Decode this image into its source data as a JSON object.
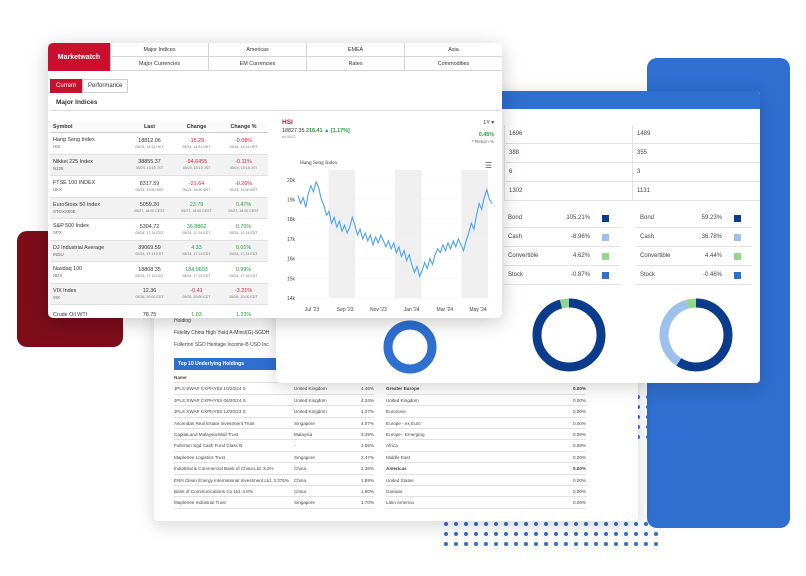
{
  "colors": {
    "brand_red": "#c8102e",
    "brand_blue": "#2f6fd0",
    "positive": "#21a03c",
    "negative": "#d6202e",
    "line": "#4aa3f0"
  },
  "marketwatch": {
    "tab_label": "Marketwatch",
    "regions": [
      "Major Indices",
      "Americas",
      "EMEA",
      "Asia",
      "Major Currencies",
      "EM Currencies",
      "Rates",
      "Commodities"
    ],
    "sub_tabs": [
      "Current",
      "Performance"
    ],
    "section_title": "Major Indices",
    "columns": [
      "Symbol",
      "Last",
      "Change",
      "Change %"
    ],
    "rows": [
      {
        "name": "Hang Seng Index",
        "sym": "HSI",
        "last": "18812.06",
        "last_date": "05/24, 14:31 HKT",
        "change": "-15.29",
        "change_date": "05/24, 14:31 HKT",
        "pct": "-0.08%",
        "pct_date": "05/24, 14:31 HKT",
        "dir": "neg"
      },
      {
        "name": "Nikkei 225 Index",
        "sym": "N225",
        "last": "38855.37",
        "last_date": "05/24, 15:15 JST",
        "change": "-94.6455",
        "change_date": "05/24, 15:15 JST",
        "pct": "-0.11%",
        "pct_date": "05/24, 15:15 JST",
        "dir": "neg"
      },
      {
        "name": "FTSE 100 INDEX",
        "sym": "UKX",
        "last": "8317.59",
        "last_date": "05/24, 16:50 BST",
        "change": "-21.64",
        "change_date": "05/24, 16:50 BST",
        "pct": "-0.26%",
        "pct_date": "05/24, 16:50 BST",
        "dir": "neg"
      },
      {
        "name": "EuroStoxx 50 Index",
        "sym": "STOXX50E",
        "last": "5059.20",
        "last_date": "05/27, 18:00 CEST",
        "change": "23.79",
        "change_date": "05/27, 18:00 CEST",
        "pct": "0.47%",
        "pct_date": "05/27, 18:00 CEST",
        "dir": "pos"
      },
      {
        "name": "S&P 500 Index",
        "sym": "SPX",
        "last": "5304.72",
        "last_date": "05/24, 17:14 EDT",
        "change": "36.8802",
        "change_date": "05/24, 17:14 EDT",
        "pct": "0.70%",
        "pct_date": "05/24, 17:14 EDT",
        "dir": "pos"
      },
      {
        "name": "DJ Industrial Average",
        "sym": "INDU",
        "last": "39069.59",
        "last_date": "05/24, 17:14 EDT",
        "change": "4.33",
        "change_date": "05/24, 17:14 EDT",
        "pct": "0.01%",
        "pct_date": "05/24, 17:14 EDT",
        "dir": "pos"
      },
      {
        "name": "Nasdaq 100",
        "sym": "NDX",
        "last": "18808.35",
        "last_date": "05/24, 17:15 EDT",
        "change": "184.9603",
        "change_date": "05/24, 17:15 EDT",
        "pct": "0.99%",
        "pct_date": "05/24, 17:15 EDT",
        "dir": "pos"
      },
      {
        "name": "VIX Index",
        "sym": "VIX",
        "last": "12.36",
        "last_date": "05/26, 20:00 EDT",
        "change": "-0.41",
        "change_date": "05/26, 20:00 EDT",
        "pct": "-3.21%",
        "pct_date": "05/26, 20:00 EDT",
        "dir": "neg"
      },
      {
        "name": "Crude Oil WTI",
        "sym": "",
        "last": "78.75",
        "last_date": "",
        "change": "1.03",
        "change_date": "",
        "pct": "1.33%",
        "pct_date": "",
        "dir": "pos"
      }
    ]
  },
  "hsi": {
    "symbol": "HSI",
    "value": "18827.35",
    "change": "218.41",
    "change_pct": "[1.17%]",
    "date": "on 05/27",
    "range": "1Y",
    "return_value": "0.45%",
    "return_label": "Return %"
  },
  "chart_data": {
    "type": "line",
    "title": "Hang Seng Index",
    "xlabel": "",
    "ylabel": "",
    "x_ticks": [
      "Jul '23",
      "Sep '23",
      "Nov '23",
      "Jan '24",
      "Mar '24",
      "May '24"
    ],
    "y_ticks": [
      "14k",
      "15k",
      "16k",
      "17k",
      "18k",
      "19k",
      "20k"
    ],
    "ylim": [
      14000,
      20500
    ],
    "series": [
      {
        "values": [
          19200,
          18800,
          19100,
          18600,
          19300,
          19700,
          19400,
          19900,
          19600,
          19000,
          18700,
          18200,
          18400,
          17800,
          18100,
          17600,
          17900,
          17400,
          17700,
          17300,
          17600,
          18100,
          17700,
          17200,
          17500,
          17000,
          17300,
          16900,
          17200,
          16700,
          17100,
          16800,
          17200,
          16900,
          16600,
          16900,
          16500,
          16800,
          16300,
          16600,
          16100,
          16400,
          15900,
          16200,
          15700,
          15300,
          15600,
          15100,
          15400,
          15800,
          15500,
          16000,
          15700,
          16200,
          16500,
          16300,
          16700,
          16400,
          16800,
          16500,
          16900,
          16600,
          17000,
          16700,
          16400,
          16900,
          17300,
          17800,
          17500,
          18200,
          18800,
          18500,
          19100,
          19500,
          19000,
          18800
        ]
      }
    ],
    "grid": true
  },
  "allocation": {
    "grid_rows": [
      [
        "1696",
        "1489"
      ],
      [
        "388",
        "355"
      ],
      [
        "6",
        "3"
      ],
      [
        "1302",
        "1131"
      ]
    ],
    "left": [
      {
        "name": "Bond",
        "value": "105.21%",
        "color": "#0b3c8c"
      },
      {
        "name": "Cash",
        "value": "-8.96%",
        "color": "#9ec1ec"
      },
      {
        "name": "Convertible",
        "value": "4.62%",
        "color": "#8fd88c"
      },
      {
        "name": "Stock",
        "value": "-0.87%",
        "color": "#2f6fd0"
      }
    ],
    "right": [
      {
        "name": "Bond",
        "value": "59.23%",
        "color": "#0b3c8c"
      },
      {
        "name": "Cash",
        "value": "36.78%",
        "color": "#9ec1ec"
      },
      {
        "name": "Convertible",
        "value": "4.44%",
        "color": "#8fd88c"
      },
      {
        "name": "Stock",
        "value": "-0.46%",
        "color": "#2f6fd0"
      }
    ]
  },
  "holdings": {
    "header_rows": [
      "Holding",
      "Fidelity China High Yield A-Mincl(G)-SGDH",
      "Fullerton SGD Heritage Income-B USD Inc"
    ],
    "title": "Top 10 Underlying Holdings",
    "name_label": "Name",
    "rows": [
      [
        "JPLS SWAP CXPHY5S 10/20/24 S",
        "United Kingdom",
        "4.46%"
      ],
      [
        "JPLS SWAP CXPHY5S 06/20/24 S",
        "United Kingdom",
        "4.34%"
      ],
      [
        "JPLS SWAP CXPHY5S 12/20/23 S",
        "United Kingdom",
        "4.27%"
      ],
      [
        "Ascendas Real Estate Investment Trust",
        "Singapore",
        "4.07%"
      ],
      [
        "CapitaLand Malaysia Mall Trust",
        "Malaysia",
        "3.49%"
      ],
      [
        "Fullerton Sgd Cash Fund Class B",
        "-",
        "2.65%"
      ],
      [
        "Mapletree Logistics Trust",
        "Singapore",
        "2.47%"
      ],
      [
        "Industrial & Commercial Bank of China Ltd. 3.2%",
        "China",
        "2.36%"
      ],
      [
        "ENN Clean Energy International Investment Ltd. 3.375%",
        "China",
        "1.89%"
      ],
      [
        "Bank of Communications Co Ltd. 3.8%",
        "China",
        "1.80%"
      ],
      [
        "Mapletree Industrial Trust",
        "Singapore",
        "1.70%"
      ]
    ],
    "geo_rows": [
      [
        "Greater Europe",
        "0.00%",
        true
      ],
      [
        "United Kingdom",
        "0.00%",
        false
      ],
      [
        "Eurozone",
        "0.00%",
        false
      ],
      [
        "Europe - ex Euro",
        "0.00%",
        false
      ],
      [
        "Europe - Emerging",
        "0.00%",
        false
      ],
      [
        "Africa",
        "0.00%",
        false
      ],
      [
        "Middle East",
        "0.00%",
        false
      ],
      [
        "Americas",
        "0.00%",
        true
      ],
      [
        "United States",
        "0.00%",
        false
      ],
      [
        "Canada",
        "0.00%",
        false
      ],
      [
        "Latin America",
        "0.00%",
        false
      ]
    ]
  }
}
